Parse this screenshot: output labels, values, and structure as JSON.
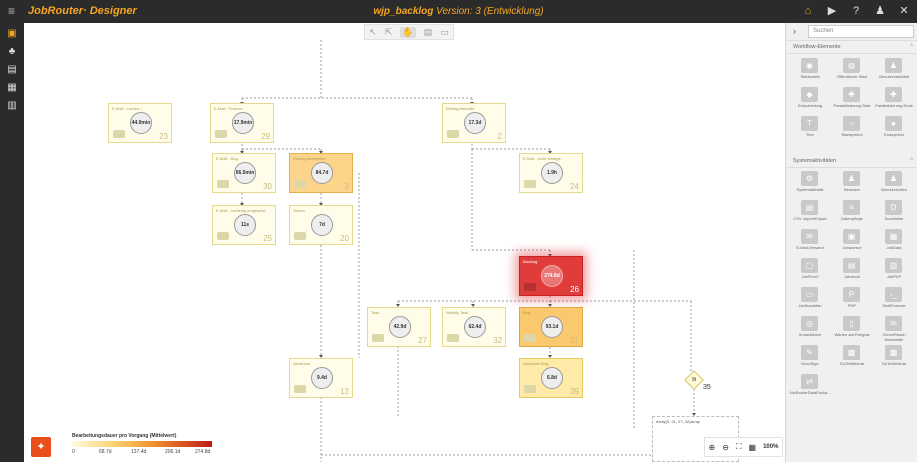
{
  "app": {
    "brand": "JobRouter· Designer",
    "project": "wjp_backlog",
    "version": "Version: 3 (Entwicklung)"
  },
  "toolbar_icons": [
    "home-icon",
    "play-icon",
    "help-icon",
    "user-icon",
    "close-icon"
  ],
  "left_icons": [
    "process-icon",
    "tree-icon",
    "database-icon",
    "report-icon",
    "document-icon"
  ],
  "canvas_tools": [
    "cursor-icon",
    "pointer-icon",
    "hand-icon",
    "grid-icon",
    "page-icon"
  ],
  "nodes": [
    {
      "label": "E-Mail - vorherr...",
      "value": "44.9min",
      "count": "23",
      "tone": "light"
    },
    {
      "label": "E-Mail - Frames",
      "value": "17.9min",
      "count": "29",
      "tone": "light"
    },
    {
      "label": "Eintrag beendet",
      "value": "17.3d",
      "count": "2",
      "tone": "light"
    },
    {
      "label": "E-Mail - Bug",
      "value": "66.5min",
      "count": "30",
      "tone": "light"
    },
    {
      "label": "Eintrag bearbeiten",
      "value": "84.7d",
      "count": "3",
      "tone": "o2"
    },
    {
      "label": "E-Mail - nicht freitags",
      "value": "1.9h",
      "count": "24",
      "tone": "light"
    },
    {
      "label": "E-Mail - vorläufig umgesetzt",
      "value": "11s",
      "count": "25",
      "tone": "light"
    },
    {
      "label": "Storno",
      "value": "7d",
      "count": "20",
      "tone": "light"
    },
    {
      "label": "Backlog",
      "value": "274.8d",
      "count": "26",
      "tone": "red"
    },
    {
      "label": "Task",
      "value": "42.9d",
      "count": "27",
      "tone": "light"
    },
    {
      "label": "Weekly Task",
      "value": "62.4d",
      "count": "32",
      "tone": "light"
    },
    {
      "label": "Bug",
      "value": "93.1d",
      "count": "21",
      "tone": "o3"
    },
    {
      "label": "Abnahme",
      "value": "9.4d",
      "count": "12",
      "tone": "light"
    },
    {
      "label": "Abnahme Bug",
      "value": "6.8d",
      "count": "39",
      "tone": "o1"
    }
  ],
  "gateway": {
    "label": "9t",
    "count": "35"
  },
  "subprocess": {
    "label": "Array(3, 21, 27, 32)Array"
  },
  "legend": {
    "title": "Bearbeitungsdauer pro Vorgang (Mittelwert)",
    "ticks": [
      "0",
      "68.7d",
      "137.4d",
      "206.1d",
      "274.8d"
    ]
  },
  "zoom": {
    "level": "100%"
  },
  "panel": {
    "search_placeholder": "Suchen",
    "sections": [
      {
        "title": "Workflow-Elemente",
        "items": [
          {
            "label": "Startschritt",
            "icon": "start-icon"
          },
          {
            "label": "Öffentlicher Start",
            "icon": "globe-icon"
          },
          {
            "label": "Benutzeraktivität",
            "icon": "user-activity-icon"
          },
          {
            "label": "Entscheidung",
            "icon": "decision-icon"
          },
          {
            "label": "Parallelisierung Start",
            "icon": "parallel-start-icon"
          },
          {
            "label": "Parallelisierung Ende",
            "icon": "parallel-end-icon"
          },
          {
            "label": "Text",
            "icon": "text-icon"
          },
          {
            "label": "Startsymbol",
            "icon": "start-symbol-icon"
          },
          {
            "label": "Endsymbol",
            "icon": "end-symbol-icon"
          }
        ]
      },
      {
        "title": "Systemaktivitäten",
        "items": [
          {
            "label": "Systemaktivität",
            "icon": "system-activity-icon"
          },
          {
            "label": "Benutzer",
            "icon": "user-icon"
          },
          {
            "label": "Benutzerrollen",
            "icon": "user-roles-icon"
          },
          {
            "label": "CSV Import/Export",
            "icon": "csv-icon"
          },
          {
            "label": "Datenpflege",
            "icon": "data-icon"
          },
          {
            "label": "DocuWare",
            "icon": "docuware-icon"
          },
          {
            "label": "E-Mail-Versand",
            "icon": "email-icon"
          },
          {
            "label": "Jobarchive",
            "icon": "archive-icon"
          },
          {
            "label": "JobData",
            "icon": "jobdata-icon"
          },
          {
            "label": "JobFlexO",
            "icon": "jobflexo-icon"
          },
          {
            "label": "Jobdruck",
            "icon": "print-icon"
          },
          {
            "label": "JobPDF",
            "icon": "pdf-icon"
          },
          {
            "label": "JobScanMan",
            "icon": "scan-icon"
          },
          {
            "label": "PHP",
            "icon": "php-icon"
          },
          {
            "label": "ShellExecute",
            "icon": "shell-icon"
          },
          {
            "label": "SmartAdvice",
            "icon": "smart-icon"
          },
          {
            "label": "Warten auf Ereignis",
            "icon": "wait-icon"
          },
          {
            "label": "CleverReach Newsletter",
            "icon": "newsletter-icon"
          },
          {
            "label": "DocuSign",
            "icon": "docusign-icon"
          },
          {
            "label": "GoToWebinar",
            "icon": "webinar-icon"
          },
          {
            "label": "GoToWebinar",
            "icon": "webinar-icon"
          },
          {
            "label": "JobRouterDataExcha...",
            "icon": "exchange-icon"
          }
        ]
      }
    ]
  }
}
